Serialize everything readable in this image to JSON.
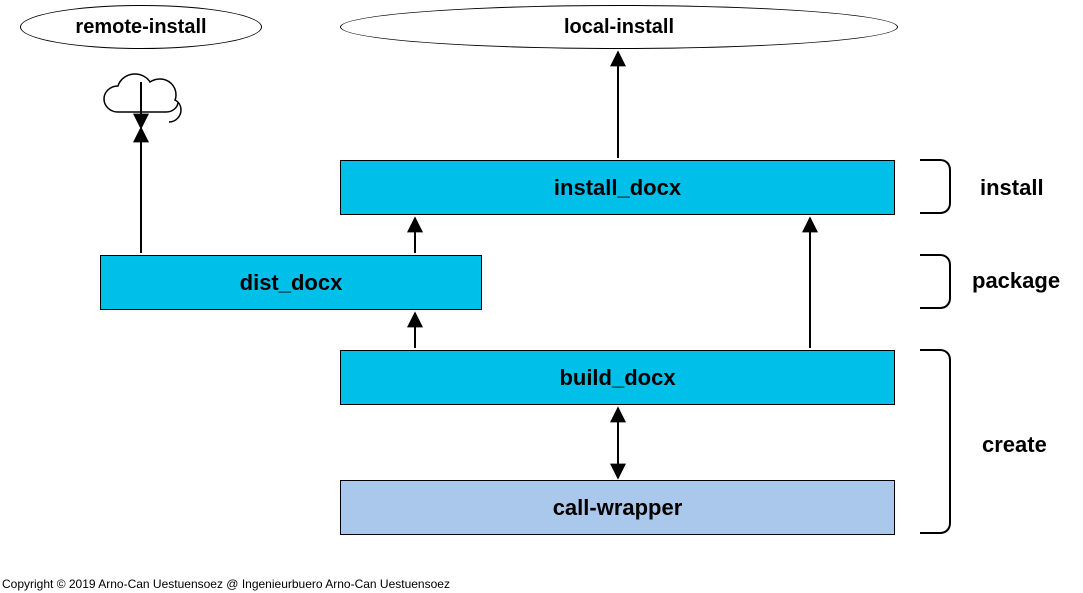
{
  "nodes": {
    "remote_install": "remote-install",
    "local_install": "local-install",
    "install_docx": "install_docx",
    "dist_docx": "dist_docx",
    "build_docx": "build_docx",
    "call_wrapper": "call-wrapper"
  },
  "phases": {
    "install": "install",
    "package": "package",
    "create": "create"
  },
  "copyright": "Copyright © 2019 Arno-Can Uestuensoez @ Ingenieurbuero Arno-Can Uestuensoez"
}
